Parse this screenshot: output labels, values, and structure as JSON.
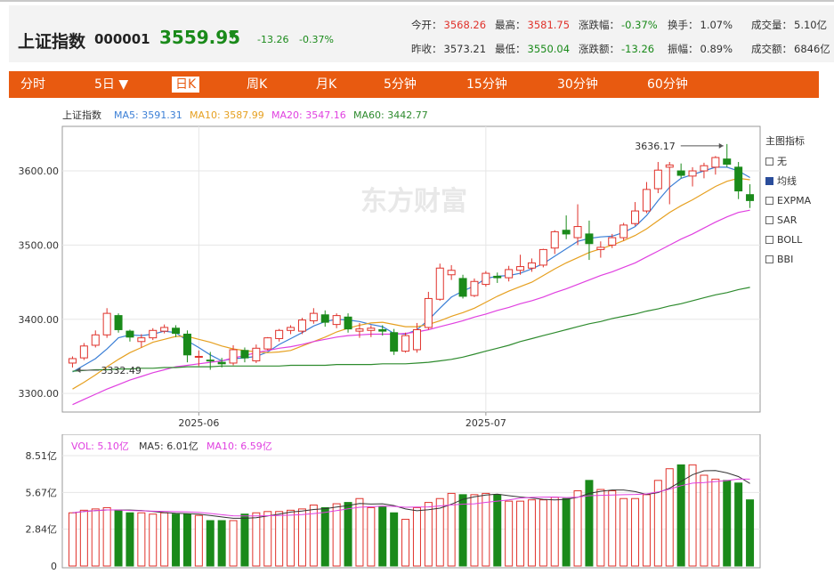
{
  "stock": {
    "name": "上证指数",
    "code": "000001",
    "price": "3559.95",
    "arrow": "▼",
    "change": "-13.26",
    "change_pct": "-0.37%"
  },
  "quote": {
    "open_label": "今开：",
    "open": "3568.26",
    "high_label": "最高：",
    "high": "3581.75",
    "chgpct_label": "涨跌幅：",
    "chgpct": "-0.37%",
    "turnover_label": "换手：",
    "turnover": "1.07%",
    "volume_label": "成交量：",
    "volume": "5.10亿",
    "prevclose_label": "昨收：",
    "prevclose": "3573.21",
    "low_label": "最低：",
    "low": "3550.04",
    "chgamt_label": "涨跌额：",
    "chgamt": "-13.26",
    "amplitude_label": "振幅：",
    "amplitude": "0.89%",
    "amount_label": "成交额：",
    "amount": "6846亿"
  },
  "tabs": [
    {
      "label": "分时"
    },
    {
      "label": "5日 ▼"
    },
    {
      "label": "日K"
    },
    {
      "label": "周K"
    },
    {
      "label": "月K"
    },
    {
      "label": "5分钟"
    },
    {
      "label": "15分钟"
    },
    {
      "label": "30分钟"
    },
    {
      "label": "60分钟"
    }
  ],
  "active_tab": "日K",
  "legend": {
    "name": "上证指数",
    "ma5": "MA5: 3591.31",
    "ma10": "MA10: 3587.99",
    "ma20": "MA20: 3547.16",
    "ma60": "MA60: 3442.77"
  },
  "watermark": "东方财富",
  "side_panel": {
    "title": "主图指标",
    "options": [
      {
        "label": "无",
        "checked": false
      },
      {
        "label": "均线",
        "checked": true
      },
      {
        "label": "EXPMA",
        "checked": false
      },
      {
        "label": "SAR",
        "checked": false
      },
      {
        "label": "BOLL",
        "checked": false
      },
      {
        "label": "BBI",
        "checked": false
      }
    ]
  },
  "vol_legend": {
    "vol": "VOL: 5.10亿",
    "ma5": "MA5: 6.01亿",
    "ma10": "MA10: 6.59亿"
  },
  "colors": {
    "up": "#e0322b",
    "down": "#1a8a1a",
    "ma5": "#3b7fd6",
    "ma10": "#e6a020",
    "ma20": "#e040e0",
    "ma60": "#2e8b2e",
    "accent": "#e85a10"
  },
  "chart_data": [
    {
      "type": "candlestick",
      "title": "上证指数",
      "y_ticks": [
        "3300.00",
        "3400.00",
        "3500.00",
        "3600.00"
      ],
      "ylim": [
        3275,
        3660
      ],
      "x_ticks": [
        "2025-06",
        "2025-07"
      ],
      "annotations": [
        {
          "text": "3636.17",
          "value": 3636.17
        },
        {
          "text": "3332.49",
          "value": 3332.49
        }
      ],
      "candles": [
        [
          3341,
          3350,
          3335,
          3347
        ],
        [
          3348,
          3368,
          3345,
          3364
        ],
        [
          3365,
          3385,
          3362,
          3379
        ],
        [
          3379,
          3415,
          3375,
          3408
        ],
        [
          3405,
          3408,
          3382,
          3386
        ],
        [
          3384,
          3386,
          3370,
          3376
        ],
        [
          3370,
          3380,
          3362,
          3375
        ],
        [
          3375,
          3388,
          3372,
          3385
        ],
        [
          3384,
          3393,
          3381,
          3389
        ],
        [
          3388,
          3392,
          3376,
          3381
        ],
        [
          3380,
          3385,
          3342,
          3352
        ],
        [
          3350,
          3358,
          3337,
          3350
        ],
        [
          3345,
          3356,
          3332,
          3344
        ],
        [
          3342,
          3348,
          3335,
          3340
        ],
        [
          3341,
          3365,
          3338,
          3359
        ],
        [
          3358,
          3362,
          3342,
          3348
        ],
        [
          3344,
          3366,
          3341,
          3361
        ],
        [
          3360,
          3376,
          3358,
          3375
        ],
        [
          3374,
          3387,
          3370,
          3385
        ],
        [
          3385,
          3392,
          3380,
          3389
        ],
        [
          3384,
          3402,
          3380,
          3399
        ],
        [
          3398,
          3415,
          3394,
          3408
        ],
        [
          3406,
          3412,
          3390,
          3396
        ],
        [
          3393,
          3408,
          3388,
          3405
        ],
        [
          3403,
          3408,
          3382,
          3387
        ],
        [
          3384,
          3395,
          3375,
          3387
        ],
        [
          3385,
          3392,
          3376,
          3388
        ],
        [
          3386,
          3392,
          3378,
          3384
        ],
        [
          3382,
          3387,
          3352,
          3357
        ],
        [
          3357,
          3382,
          3355,
          3378
        ],
        [
          3359,
          3395,
          3355,
          3386
        ],
        [
          3389,
          3437,
          3386,
          3428
        ],
        [
          3427,
          3475,
          3425,
          3469
        ],
        [
          3460,
          3473,
          3453,
          3466
        ],
        [
          3455,
          3460,
          3428,
          3431
        ],
        [
          3432,
          3455,
          3430,
          3451
        ],
        [
          3447,
          3465,
          3444,
          3462
        ],
        [
          3458,
          3463,
          3449,
          3456
        ],
        [
          3456,
          3472,
          3451,
          3467
        ],
        [
          3466,
          3487,
          3460,
          3471
        ],
        [
          3469,
          3482,
          3464,
          3476
        ],
        [
          3473,
          3495,
          3470,
          3494
        ],
        [
          3496,
          3520,
          3488,
          3518
        ],
        [
          3520,
          3540,
          3508,
          3515
        ],
        [
          3510,
          3555,
          3500,
          3525
        ],
        [
          3515,
          3533,
          3480,
          3502
        ],
        [
          3494,
          3505,
          3483,
          3497
        ],
        [
          3500,
          3515,
          3496,
          3510
        ],
        [
          3510,
          3530,
          3506,
          3527
        ],
        [
          3529,
          3558,
          3526,
          3546
        ],
        [
          3546,
          3585,
          3543,
          3575
        ],
        [
          3576,
          3612,
          3570,
          3601
        ],
        [
          3605,
          3612,
          3555,
          3608
        ],
        [
          3600,
          3610,
          3590,
          3594
        ],
        [
          3593,
          3605,
          3579,
          3600
        ],
        [
          3600,
          3611,
          3590,
          3607
        ],
        [
          3605,
          3620,
          3595,
          3618
        ],
        [
          3616,
          3636.17,
          3605,
          3609
        ],
        [
          3605,
          3612,
          3562,
          3573
        ],
        [
          3568,
          3582,
          3550,
          3560
        ]
      ],
      "series": [
        {
          "name": "MA5",
          "values": [
            3329,
            3338,
            3347,
            3360,
            3375,
            3379,
            3378,
            3380,
            3384,
            3382,
            3371,
            3362,
            3352,
            3344,
            3347,
            3348,
            3350,
            3356,
            3366,
            3374,
            3382,
            3391,
            3397,
            3400,
            3399,
            3397,
            3393,
            3390,
            3381,
            3380,
            3386,
            3399,
            3415,
            3430,
            3438,
            3445,
            3455,
            3458,
            3459,
            3462,
            3468,
            3475,
            3485,
            3495,
            3505,
            3509,
            3511,
            3512,
            3517,
            3525,
            3540,
            3560,
            3578,
            3590,
            3595,
            3600,
            3605,
            3605,
            3600,
            3591
          ]
        },
        {
          "name": "MA10",
          "values": [
            3306,
            3315,
            3325,
            3336,
            3346,
            3355,
            3362,
            3369,
            3373,
            3377,
            3377,
            3373,
            3369,
            3364,
            3360,
            3358,
            3356,
            3355,
            3356,
            3358,
            3364,
            3370,
            3376,
            3383,
            3388,
            3392,
            3395,
            3396,
            3393,
            3390,
            3390,
            3393,
            3398,
            3404,
            3409,
            3415,
            3423,
            3431,
            3438,
            3444,
            3450,
            3459,
            3468,
            3476,
            3483,
            3490,
            3495,
            3500,
            3506,
            3513,
            3522,
            3533,
            3544,
            3553,
            3561,
            3570,
            3579,
            3586,
            3590,
            3588
          ]
        },
        {
          "name": "MA20",
          "values": [
            3285,
            3292,
            3299,
            3306,
            3312,
            3318,
            3323,
            3328,
            3332,
            3336,
            3338,
            3340,
            3342,
            3344,
            3348,
            3351,
            3355,
            3358,
            3361,
            3363,
            3366,
            3370,
            3373,
            3376,
            3378,
            3379,
            3380,
            3380,
            3380,
            3381,
            3383,
            3386,
            3390,
            3394,
            3398,
            3403,
            3407,
            3412,
            3416,
            3421,
            3425,
            3430,
            3436,
            3441,
            3447,
            3453,
            3459,
            3464,
            3470,
            3476,
            3484,
            3492,
            3500,
            3508,
            3515,
            3523,
            3531,
            3538,
            3544,
            3547
          ]
        },
        {
          "name": "MA60",
          "values": [
            3330,
            3331,
            3332,
            3332,
            3333,
            3333,
            3334,
            3334,
            3335,
            3335,
            3336,
            3336,
            3336,
            3337,
            3337,
            3337,
            3337,
            3337,
            3337,
            3338,
            3338,
            3338,
            3338,
            3339,
            3339,
            3339,
            3339,
            3340,
            3340,
            3340,
            3341,
            3342,
            3344,
            3346,
            3349,
            3353,
            3357,
            3361,
            3365,
            3370,
            3374,
            3378,
            3382,
            3386,
            3390,
            3394,
            3397,
            3401,
            3404,
            3407,
            3411,
            3414,
            3418,
            3421,
            3425,
            3429,
            3433,
            3436,
            3440,
            3443
          ]
        }
      ]
    },
    {
      "type": "bar",
      "title": "VOL",
      "y_ticks": [
        "8.51亿",
        "5.67亿",
        "2.84亿",
        "0"
      ],
      "ylim": [
        0,
        8.51
      ],
      "unit": "亿",
      "values": [
        4.1,
        4.3,
        4.4,
        4.5,
        4.3,
        4.1,
        4.1,
        4.0,
        4.1,
        4.0,
        4.0,
        3.9,
        3.5,
        3.5,
        3.5,
        4.0,
        4.1,
        4.2,
        4.2,
        4.3,
        4.4,
        4.7,
        4.5,
        4.8,
        4.9,
        5.2,
        4.5,
        4.6,
        4.1,
        3.6,
        4.5,
        4.9,
        5.2,
        5.6,
        5.5,
        5.5,
        5.6,
        5.5,
        5.0,
        5.0,
        5.1,
        5.1,
        5.3,
        5.2,
        5.8,
        6.6,
        5.9,
        5.8,
        5.2,
        5.2,
        5.5,
        6.6,
        7.5,
        7.8,
        7.8,
        7.0,
        6.7,
        6.6,
        6.4,
        5.1
      ]
    }
  ]
}
